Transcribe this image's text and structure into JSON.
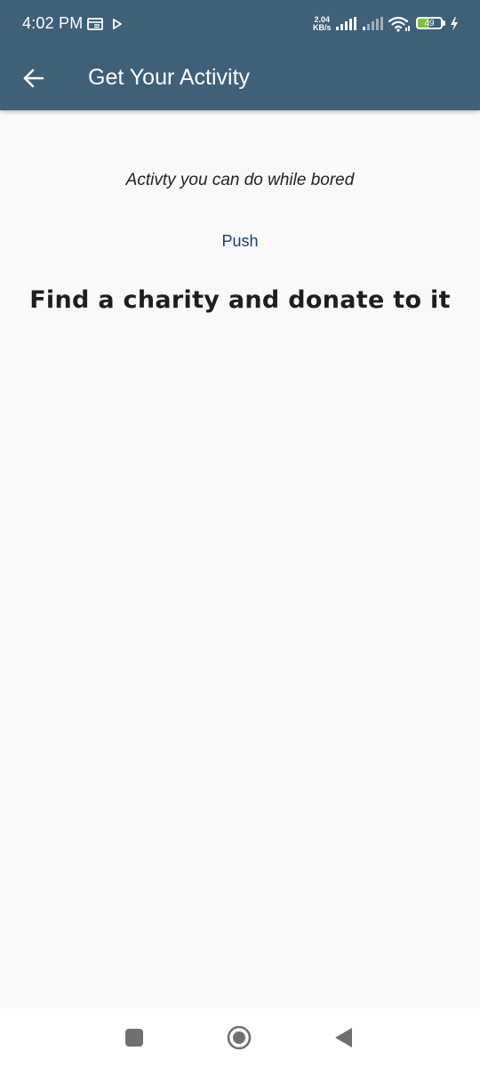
{
  "status_bar": {
    "time": "4:02 PM",
    "net_speed_value": "2.04",
    "net_speed_unit": "KB/s",
    "battery_level": "49"
  },
  "app_bar": {
    "title": "Get Your Activity",
    "background_color": "#3e6079"
  },
  "content": {
    "subtitle": "Activty you can do while bored",
    "button_label": "Push",
    "activity_text": "Find a charity and donate to it"
  },
  "nav_bar": {
    "buttons": [
      "recents-square-icon",
      "home-circle-icon",
      "back-triangle-icon"
    ]
  }
}
